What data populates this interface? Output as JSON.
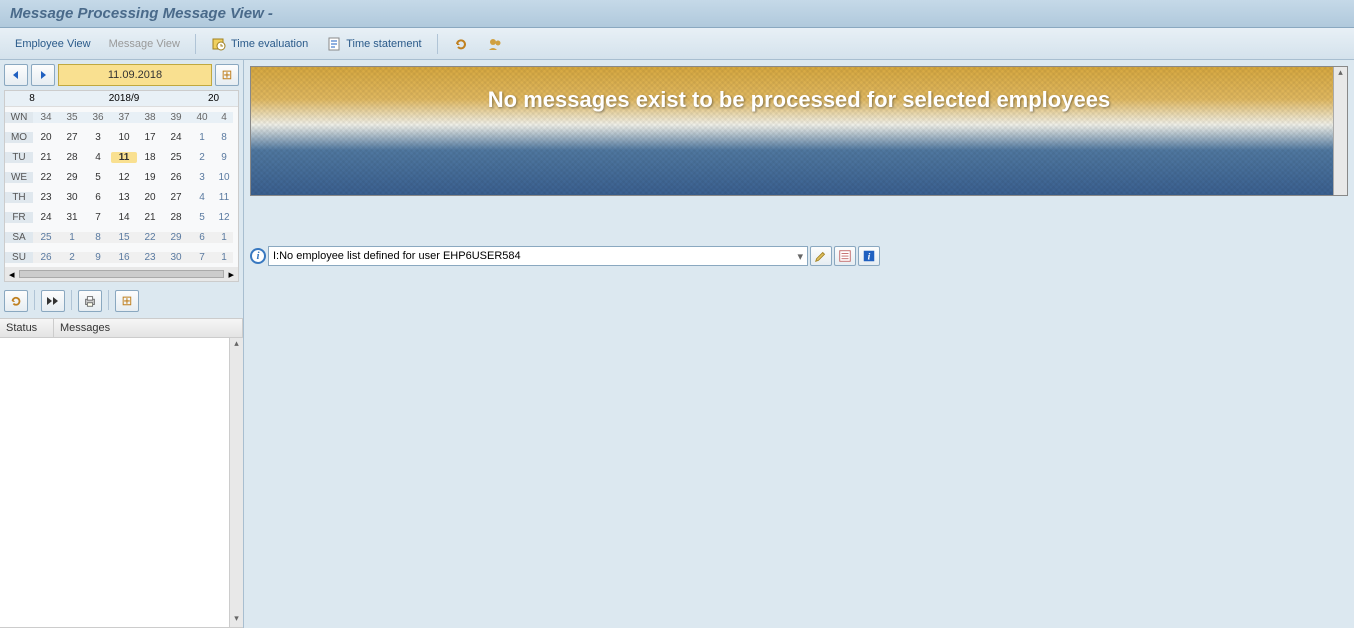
{
  "title": "Message Processing Message View -",
  "toolbar": {
    "employee_view": "Employee View",
    "message_view": "Message View",
    "time_evaluation": "Time evaluation",
    "time_statement": "Time statement"
  },
  "nav": {
    "date": "11.09.2018"
  },
  "calendar": {
    "month_left": "8",
    "month_center": "2018/9",
    "month_right": "20",
    "wn_label": "WN",
    "week_nums": [
      "34",
      "35",
      "36",
      "37",
      "38",
      "39",
      "40",
      "4"
    ],
    "days": [
      "MO",
      "TU",
      "WE",
      "TH",
      "FR",
      "SA",
      "SU"
    ],
    "rows": [
      [
        "20",
        "27",
        "3",
        "10",
        "17",
        "24",
        "1",
        "8"
      ],
      [
        "21",
        "28",
        "4",
        "11",
        "18",
        "25",
        "2",
        "9"
      ],
      [
        "22",
        "29",
        "5",
        "12",
        "19",
        "26",
        "3",
        "10"
      ],
      [
        "23",
        "30",
        "6",
        "13",
        "20",
        "27",
        "4",
        "11"
      ],
      [
        "24",
        "31",
        "7",
        "14",
        "21",
        "28",
        "5",
        "12"
      ],
      [
        "25",
        "1",
        "8",
        "15",
        "22",
        "29",
        "6",
        "1"
      ],
      [
        "26",
        "2",
        "9",
        "16",
        "23",
        "30",
        "7",
        "1"
      ]
    ],
    "today": {
      "row": 1,
      "col": 3
    }
  },
  "table": {
    "col_status": "Status",
    "col_messages": "Messages"
  },
  "banner": {
    "text": "No messages exist to be processed for selected employees"
  },
  "status": {
    "message": "I:No employee list defined for user EHP6USER584"
  }
}
